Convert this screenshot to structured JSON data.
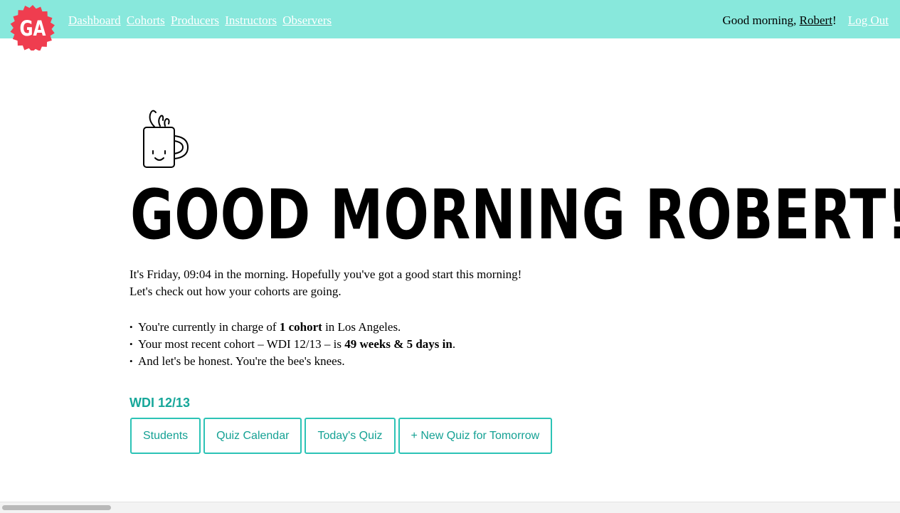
{
  "brand": {
    "logo_text": "GA",
    "logo_color": "#ef3d4f"
  },
  "header": {
    "bg_color": "#88e8dc",
    "nav": [
      "Dashboard",
      "Cohorts",
      "Producers",
      "Instructors",
      "Observers"
    ],
    "greeting_prefix": "Good morning, ",
    "user_name": "Robert",
    "greeting_suffix": "!",
    "logout_label": "Log Out"
  },
  "hero": {
    "icon": "coffee-mug-icon",
    "title": "GOOD MORNING ROBERT!"
  },
  "intro": {
    "line1_a": "It's Friday, ",
    "time": "09:04",
    "line1_b": " in the morning. Hopefully you've got a good start this morning!",
    "line2": "Let's check out how your cohorts are going."
  },
  "bullets": {
    "b1_a": "You're currently in charge of ",
    "b1_bold": "1 cohort",
    "b1_b": " in Los Angeles.",
    "b2_a": "Your most recent cohort – WDI 12/13 – is ",
    "b2_bold": "49 weeks & 5 days in",
    "b2_b": ".",
    "b3": "And let's be honest. You're the bee's knees."
  },
  "cohort": {
    "name": "WDI 12/13",
    "accent_color": "#17a79a",
    "buttons": [
      "Students",
      "Quiz Calendar",
      "Today's Quiz",
      "+ New Quiz for Tomorrow"
    ]
  }
}
